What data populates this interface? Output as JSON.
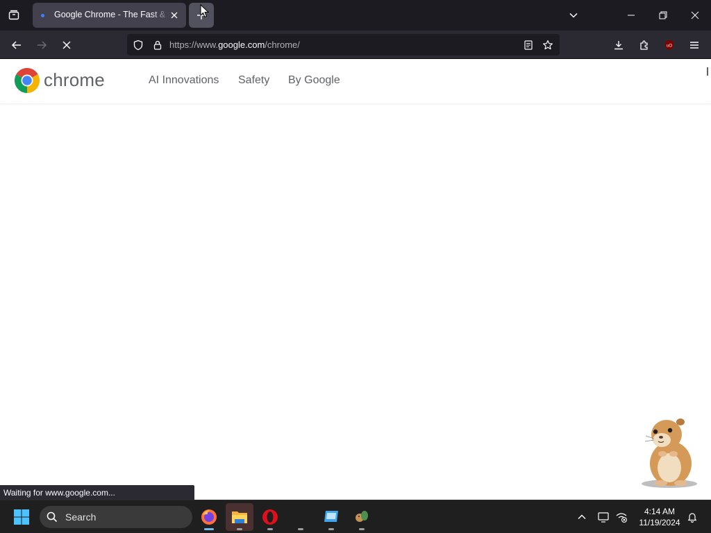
{
  "browser": {
    "active_tab": {
      "title": "Google Chrome - The Fast & Secure Web Browser Built to be Yours"
    },
    "new_tab_label": "+",
    "url": {
      "scheme": "https://www.",
      "host": "google.com",
      "path": "/chrome/"
    },
    "status_text": "Waiting for www.google.com...",
    "ublock_badge": "uO"
  },
  "site": {
    "logo_text": "chrome",
    "nav": {
      "ai": "AI Innovations",
      "safety": "Safety",
      "by_google": "By Google"
    }
  },
  "taskbar": {
    "search_label": "Search",
    "clock": {
      "time": "4:14 AM",
      "date": "11/19/2024"
    }
  },
  "colors": {
    "tab_bar": "#1c1b22",
    "nav_bar": "#2b2a33",
    "taskbar": "#1f1f1f",
    "site_text": "#5f6368",
    "accent": "#76b9ed"
  },
  "icons": [
    "tab-list-icon",
    "close-tab-icon",
    "plus-icon",
    "chevron-down-icon",
    "minimize-icon",
    "restore-icon",
    "close-window-icon",
    "back-arrow-icon",
    "forward-arrow-icon",
    "stop-icon",
    "shield-icon",
    "lock-icon",
    "reader-view-icon",
    "bookmark-star-icon",
    "download-icon",
    "extensions-icon",
    "ublock-icon",
    "hamburger-menu-icon",
    "chrome-logo-icon",
    "windows-start-icon",
    "search-icon",
    "firefox-icon",
    "file-explorer-icon",
    "opera-icon",
    "chevron-up-icon",
    "display-icon",
    "network-icon",
    "notification-bell-icon"
  ]
}
